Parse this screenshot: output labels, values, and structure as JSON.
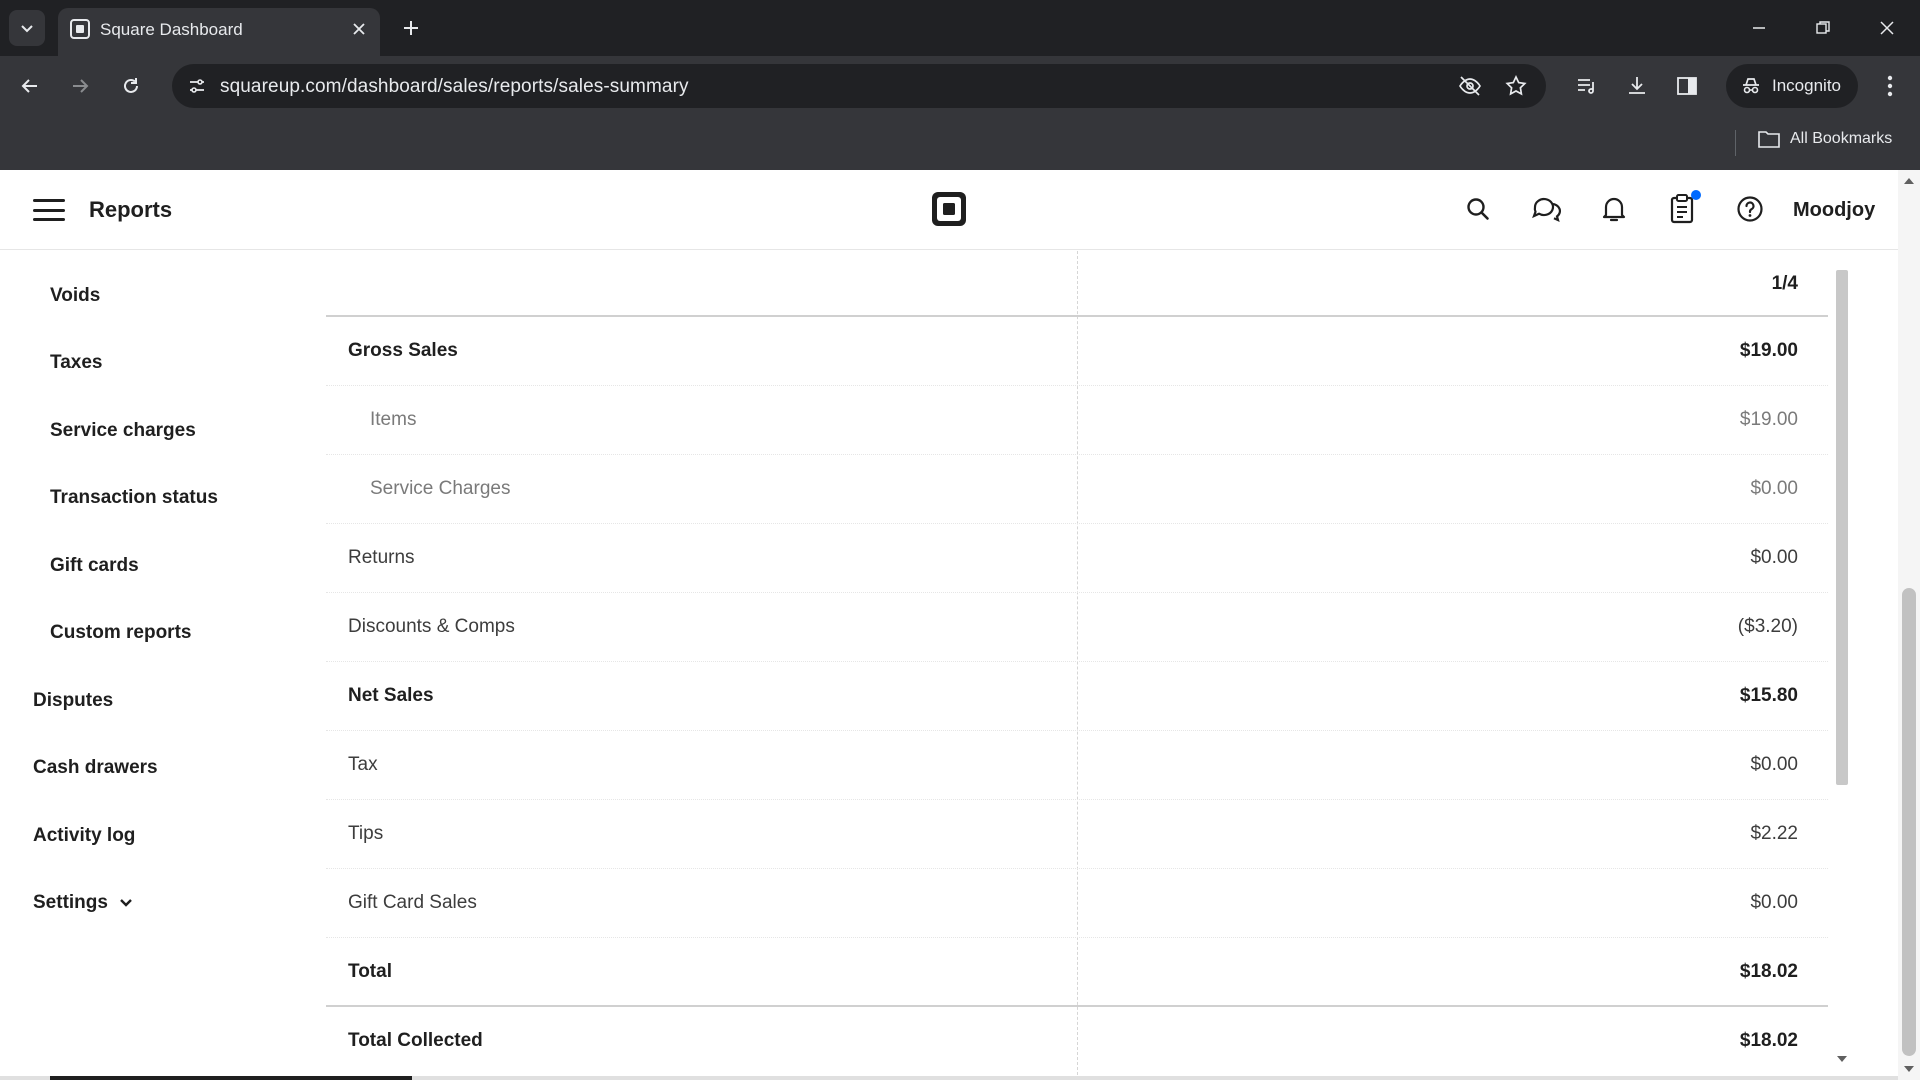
{
  "browser": {
    "tab_title": "Square Dashboard",
    "url": "squareup.com/dashboard/sales/reports/sales-summary",
    "incognito_label": "Incognito",
    "all_bookmarks_label": "All Bookmarks"
  },
  "header": {
    "title": "Reports",
    "account_name": "Moodjoy"
  },
  "sidebar": {
    "sub_items": [
      {
        "label": "Voids"
      },
      {
        "label": "Taxes"
      },
      {
        "label": "Service charges"
      },
      {
        "label": "Transaction status"
      },
      {
        "label": "Gift cards"
      },
      {
        "label": "Custom reports"
      }
    ],
    "top_items": [
      {
        "label": "Disputes"
      },
      {
        "label": "Cash drawers"
      },
      {
        "label": "Activity log"
      },
      {
        "label": "Settings"
      }
    ]
  },
  "report": {
    "page_indicator": "1/4",
    "rows": [
      {
        "label": "Gross Sales",
        "value": "$19.00"
      },
      {
        "label": "Items",
        "value": "$19.00"
      },
      {
        "label": "Service Charges",
        "value": "$0.00"
      },
      {
        "label": "Returns",
        "value": "$0.00"
      },
      {
        "label": "Discounts & Comps",
        "value": "($3.20)"
      },
      {
        "label": "Net Sales",
        "value": "$15.80"
      },
      {
        "label": "Tax",
        "value": "$0.00"
      },
      {
        "label": "Tips",
        "value": "$2.22"
      },
      {
        "label": "Gift Card Sales",
        "value": "$0.00"
      },
      {
        "label": "Total",
        "value": "$18.02"
      },
      {
        "label": "Total Collected",
        "value": "$18.02"
      }
    ]
  },
  "colors": {
    "chrome_dark": "#202124",
    "chrome_toolbar": "#35363a",
    "notification_dot": "#006aff"
  }
}
